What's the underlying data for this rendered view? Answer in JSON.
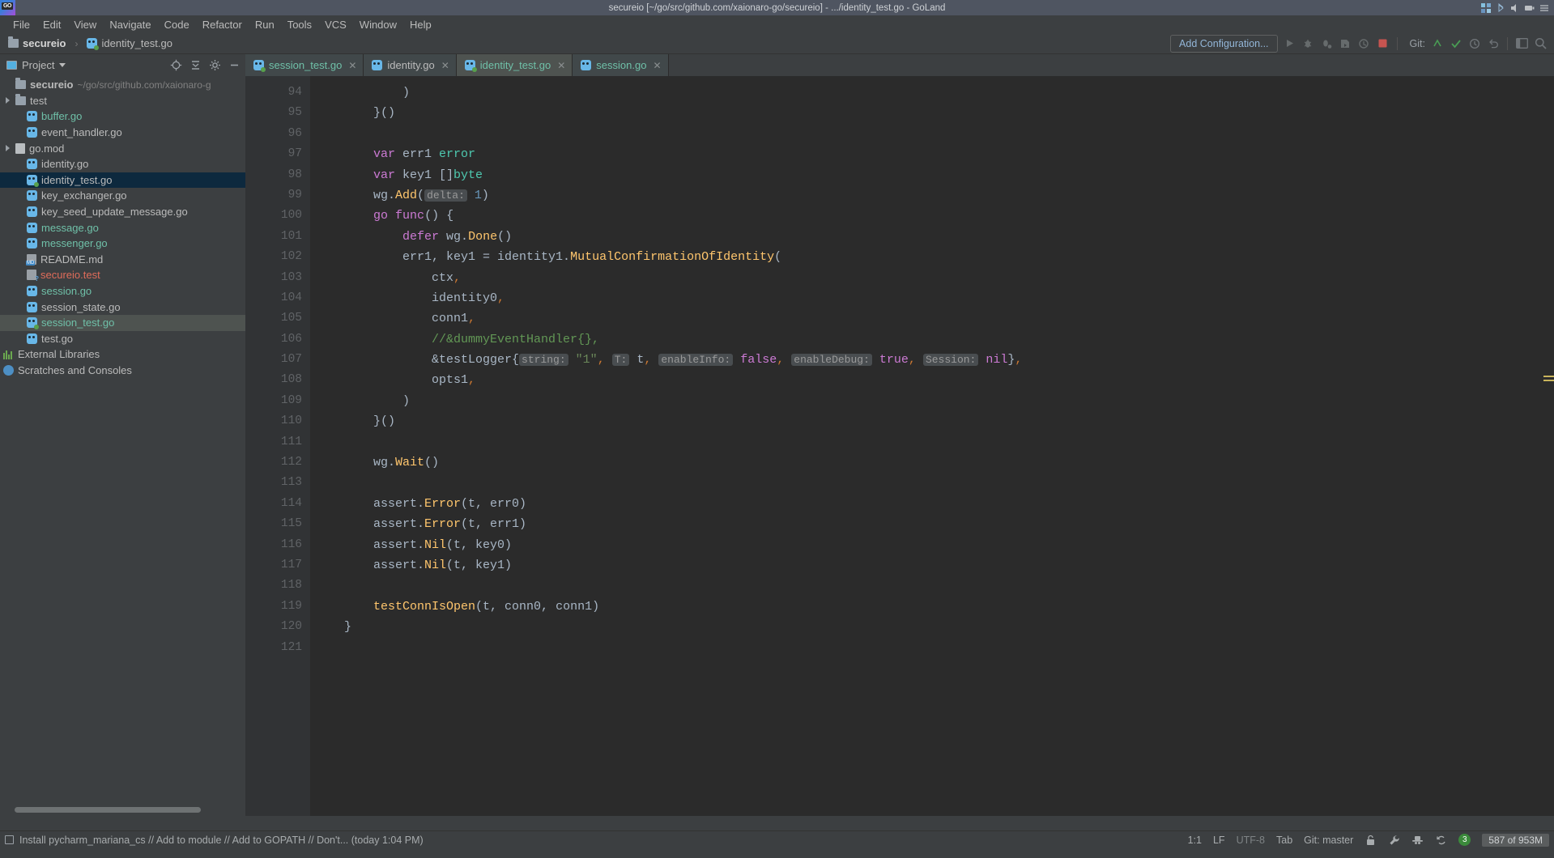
{
  "window": {
    "title": "secureio [~/go/src/github.com/xaionaro-go/secureio] - .../identity_test.go - GoLand"
  },
  "menubar": {
    "items": [
      "File",
      "Edit",
      "View",
      "Navigate",
      "Code",
      "Refactor",
      "Run",
      "Tools",
      "VCS",
      "Window",
      "Help"
    ]
  },
  "breadcrumb": {
    "project": "secureio",
    "separator": "›",
    "file": "identity_test.go"
  },
  "toolbar": {
    "add_configuration": "Add Configuration...",
    "git_label": "Git:",
    "icons": [
      "run-icon",
      "debug-icon",
      "debug-with-coverage-icon",
      "profile-icon",
      "attach-icon",
      "stop-icon"
    ],
    "git_icons": [
      "update-project-icon",
      "commit-icon",
      "history-icon",
      "rollback-icon"
    ],
    "right_icons": [
      "layout-icon",
      "search-everywhere-icon"
    ]
  },
  "project_panel": {
    "title": "Project",
    "header_icons": [
      "target-icon",
      "collapse-all-icon",
      "settings-icon",
      "hide-icon"
    ],
    "root": {
      "label": "secureio",
      "path": "~/go/src/github.com/xaionaro-g"
    },
    "items": [
      {
        "label": "test",
        "icon": "folder-icon",
        "color": "white",
        "arrow": true,
        "indent": 1
      },
      {
        "label": "buffer.go",
        "icon": "go-file-icon",
        "color": "green",
        "arrow": false,
        "indent": 2
      },
      {
        "label": "event_handler.go",
        "icon": "go-file-icon",
        "color": "white",
        "arrow": false,
        "indent": 2
      },
      {
        "label": "go.mod",
        "icon": "module-icon",
        "color": "white",
        "arrow": true,
        "indent": 1
      },
      {
        "label": "identity.go",
        "icon": "go-file-icon",
        "color": "white",
        "arrow": false,
        "indent": 2
      },
      {
        "label": "identity_test.go",
        "icon": "go-test-icon",
        "color": "white",
        "arrow": false,
        "indent": 2,
        "selected": "primary"
      },
      {
        "label": "key_exchanger.go",
        "icon": "go-file-icon",
        "color": "white",
        "arrow": false,
        "indent": 2
      },
      {
        "label": "key_seed_update_message.go",
        "icon": "go-file-icon",
        "color": "white",
        "arrow": false,
        "indent": 2
      },
      {
        "label": "message.go",
        "icon": "go-file-icon",
        "color": "green",
        "arrow": false,
        "indent": 2
      },
      {
        "label": "messenger.go",
        "icon": "go-file-icon",
        "color": "green",
        "arrow": false,
        "indent": 2
      },
      {
        "label": "README.md",
        "icon": "markdown-icon",
        "color": "white",
        "arrow": false,
        "indent": 2
      },
      {
        "label": "secureio.test",
        "icon": "unknown-file-icon",
        "color": "red",
        "arrow": false,
        "indent": 2
      },
      {
        "label": "session.go",
        "icon": "go-file-icon",
        "color": "green",
        "arrow": false,
        "indent": 2
      },
      {
        "label": "session_state.go",
        "icon": "go-file-icon",
        "color": "white",
        "arrow": false,
        "indent": 2
      },
      {
        "label": "session_test.go",
        "icon": "go-test-icon",
        "color": "green",
        "arrow": false,
        "indent": 2,
        "selected": "secondary"
      },
      {
        "label": "test.go",
        "icon": "go-file-icon",
        "color": "white",
        "arrow": false,
        "indent": 2
      },
      {
        "label": "External Libraries",
        "icon": "libraries-icon",
        "color": "white",
        "arrow": false,
        "indent": 0
      },
      {
        "label": "Scratches and Consoles",
        "icon": "scratches-icon",
        "color": "white",
        "arrow": false,
        "indent": 0
      }
    ]
  },
  "tabs": [
    {
      "label": "session_test.go",
      "icon": "go-test-icon",
      "color": "green",
      "active": false,
      "closable": true
    },
    {
      "label": "identity.go",
      "icon": "go-file-icon",
      "color": "white",
      "active": false,
      "closable": true
    },
    {
      "label": "identity_test.go",
      "icon": "go-test-icon",
      "color": "green",
      "active": true,
      "closable": true
    },
    {
      "label": "session.go",
      "icon": "go-file-icon",
      "color": "green",
      "active": false,
      "closable": true
    }
  ],
  "editor": {
    "first_line": 94,
    "lines": [
      {
        "n": 94,
        "fold": false,
        "tokens": [
          {
            "t": "\t\t\t)",
            "c": "pn"
          }
        ]
      },
      {
        "n": 95,
        "fold": true,
        "tokens": [
          {
            "t": "\t\t}()",
            "c": "pn"
          }
        ]
      },
      {
        "n": 96,
        "fold": false,
        "tokens": []
      },
      {
        "n": 97,
        "fold": false,
        "tokens": [
          {
            "t": "\t\t",
            "c": "pn"
          },
          {
            "t": "var",
            "c": "k"
          },
          {
            "t": " err1 ",
            "c": "pn"
          },
          {
            "t": "error",
            "c": "ty"
          }
        ]
      },
      {
        "n": 98,
        "fold": false,
        "tokens": [
          {
            "t": "\t\t",
            "c": "pn"
          },
          {
            "t": "var",
            "c": "k"
          },
          {
            "t": " key1 []",
            "c": "pn"
          },
          {
            "t": "byte",
            "c": "ty"
          }
        ]
      },
      {
        "n": 99,
        "fold": false,
        "tokens": [
          {
            "t": "\t\twg.",
            "c": "pn"
          },
          {
            "t": "Add",
            "c": "fn"
          },
          {
            "t": "(",
            "c": "pn"
          },
          {
            "t": "delta:",
            "c": "hint"
          },
          {
            "t": " ",
            "c": "pn"
          },
          {
            "t": "1",
            "c": "num"
          },
          {
            "t": ")",
            "c": "pn"
          }
        ]
      },
      {
        "n": 100,
        "fold": true,
        "tokens": [
          {
            "t": "\t\t",
            "c": "pn"
          },
          {
            "t": "go",
            "c": "k"
          },
          {
            "t": " ",
            "c": "pn"
          },
          {
            "t": "func",
            "c": "k"
          },
          {
            "t": "() {",
            "c": "pn"
          }
        ]
      },
      {
        "n": 101,
        "fold": false,
        "tokens": [
          {
            "t": "\t\t\t",
            "c": "pn"
          },
          {
            "t": "defer",
            "c": "k"
          },
          {
            "t": " wg.",
            "c": "pn"
          },
          {
            "t": "Done",
            "c": "fn"
          },
          {
            "t": "()",
            "c": "pn"
          }
        ]
      },
      {
        "n": 102,
        "fold": false,
        "tokens": [
          {
            "t": "\t\t\terr1, key1 = identity1.",
            "c": "pn"
          },
          {
            "t": "MutualConfirmationOfIdentity",
            "c": "fn"
          },
          {
            "t": "(",
            "c": "pn"
          }
        ]
      },
      {
        "n": 103,
        "fold": false,
        "tokens": [
          {
            "t": "\t\t\t\tctx",
            "c": "pn"
          },
          {
            "t": ",",
            "c": "op"
          }
        ]
      },
      {
        "n": 104,
        "fold": false,
        "tokens": [
          {
            "t": "\t\t\t\tidentity0",
            "c": "pn"
          },
          {
            "t": ",",
            "c": "op"
          }
        ]
      },
      {
        "n": 105,
        "fold": false,
        "tokens": [
          {
            "t": "\t\t\t\tconn1",
            "c": "pn"
          },
          {
            "t": ",",
            "c": "op"
          }
        ]
      },
      {
        "n": 106,
        "fold": false,
        "tokens": [
          {
            "t": "\t\t\t\t//&dummyEventHandler{},",
            "c": "cm"
          }
        ]
      },
      {
        "n": 107,
        "fold": false,
        "tokens": [
          {
            "t": "\t\t\t\t&testLogger{",
            "c": "pn"
          },
          {
            "t": "string:",
            "c": "hint"
          },
          {
            "t": " ",
            "c": "pn"
          },
          {
            "t": "\"1\"",
            "c": "st"
          },
          {
            "t": ",",
            "c": "op"
          },
          {
            "t": " ",
            "c": "pn"
          },
          {
            "t": "T:",
            "c": "hint"
          },
          {
            "t": " t",
            "c": "pn"
          },
          {
            "t": ",",
            "c": "op"
          },
          {
            "t": " ",
            "c": "pn"
          },
          {
            "t": "enableInfo:",
            "c": "hint"
          },
          {
            "t": " ",
            "c": "pn"
          },
          {
            "t": "false",
            "c": "k"
          },
          {
            "t": ",",
            "c": "op"
          },
          {
            "t": " ",
            "c": "pn"
          },
          {
            "t": "enableDebug:",
            "c": "hint"
          },
          {
            "t": " ",
            "c": "pn"
          },
          {
            "t": "true",
            "c": "k"
          },
          {
            "t": ",",
            "c": "op"
          },
          {
            "t": " ",
            "c": "pn"
          },
          {
            "t": "Session:",
            "c": "hint"
          },
          {
            "t": " ",
            "c": "pn"
          },
          {
            "t": "nil",
            "c": "k"
          },
          {
            "t": "}",
            "c": "pn"
          },
          {
            "t": ",",
            "c": "op"
          }
        ]
      },
      {
        "n": 108,
        "fold": false,
        "tokens": [
          {
            "t": "\t\t\t\topts1",
            "c": "pn"
          },
          {
            "t": ",",
            "c": "op"
          }
        ]
      },
      {
        "n": 109,
        "fold": false,
        "tokens": [
          {
            "t": "\t\t\t)",
            "c": "pn"
          }
        ]
      },
      {
        "n": 110,
        "fold": true,
        "tokens": [
          {
            "t": "\t\t}()",
            "c": "pn"
          }
        ]
      },
      {
        "n": 111,
        "fold": false,
        "tokens": []
      },
      {
        "n": 112,
        "fold": false,
        "tokens": [
          {
            "t": "\t\twg.",
            "c": "pn"
          },
          {
            "t": "Wait",
            "c": "fn"
          },
          {
            "t": "()",
            "c": "pn"
          }
        ]
      },
      {
        "n": 113,
        "fold": false,
        "tokens": []
      },
      {
        "n": 114,
        "fold": false,
        "tokens": [
          {
            "t": "\t\tassert.",
            "c": "pn"
          },
          {
            "t": "Error",
            "c": "fn"
          },
          {
            "t": "(t, err0)",
            "c": "pn"
          }
        ]
      },
      {
        "n": 115,
        "fold": false,
        "tokens": [
          {
            "t": "\t\tassert.",
            "c": "pn"
          },
          {
            "t": "Error",
            "c": "fn"
          },
          {
            "t": "(t, err1)",
            "c": "pn"
          }
        ]
      },
      {
        "n": 116,
        "fold": false,
        "tokens": [
          {
            "t": "\t\tassert.",
            "c": "pn"
          },
          {
            "t": "Nil",
            "c": "fn"
          },
          {
            "t": "(t, key0)",
            "c": "pn"
          }
        ]
      },
      {
        "n": 117,
        "fold": false,
        "tokens": [
          {
            "t": "\t\tassert.",
            "c": "pn"
          },
          {
            "t": "Nil",
            "c": "fn"
          },
          {
            "t": "(t, key1)",
            "c": "pn"
          }
        ]
      },
      {
        "n": 118,
        "fold": false,
        "tokens": []
      },
      {
        "n": 119,
        "fold": false,
        "tokens": [
          {
            "t": "\t\t",
            "c": "pn"
          },
          {
            "t": "testConnIsOpen",
            "c": "fn"
          },
          {
            "t": "(t, conn0, conn1)",
            "c": "pn"
          }
        ]
      },
      {
        "n": 120,
        "fold": true,
        "tokens": [
          {
            "t": "\t}",
            "c": "pn"
          }
        ]
      },
      {
        "n": 121,
        "fold": false,
        "tokens": []
      }
    ]
  },
  "statusbar": {
    "message": "Install pycharm_mariana_cs // Add to module // Add to GOPATH // Don't... (today 1:04 PM)",
    "caret": "1:1",
    "line_separator": "LF",
    "encoding": "UTF-8",
    "indent": "Tab",
    "branch": "Git: master",
    "memory": "587 of 953M",
    "notification_count": "3",
    "icons": [
      "lock-icon",
      "wrench-icon",
      "hat-icon",
      "sync-icon"
    ]
  },
  "colors": {
    "accent_green": "#6fc0a8",
    "selection_blue": "#0d293e",
    "editor_bg": "#2b2b2b",
    "panel_bg": "#3c3f41",
    "titlebar_bg": "#4f5561"
  }
}
